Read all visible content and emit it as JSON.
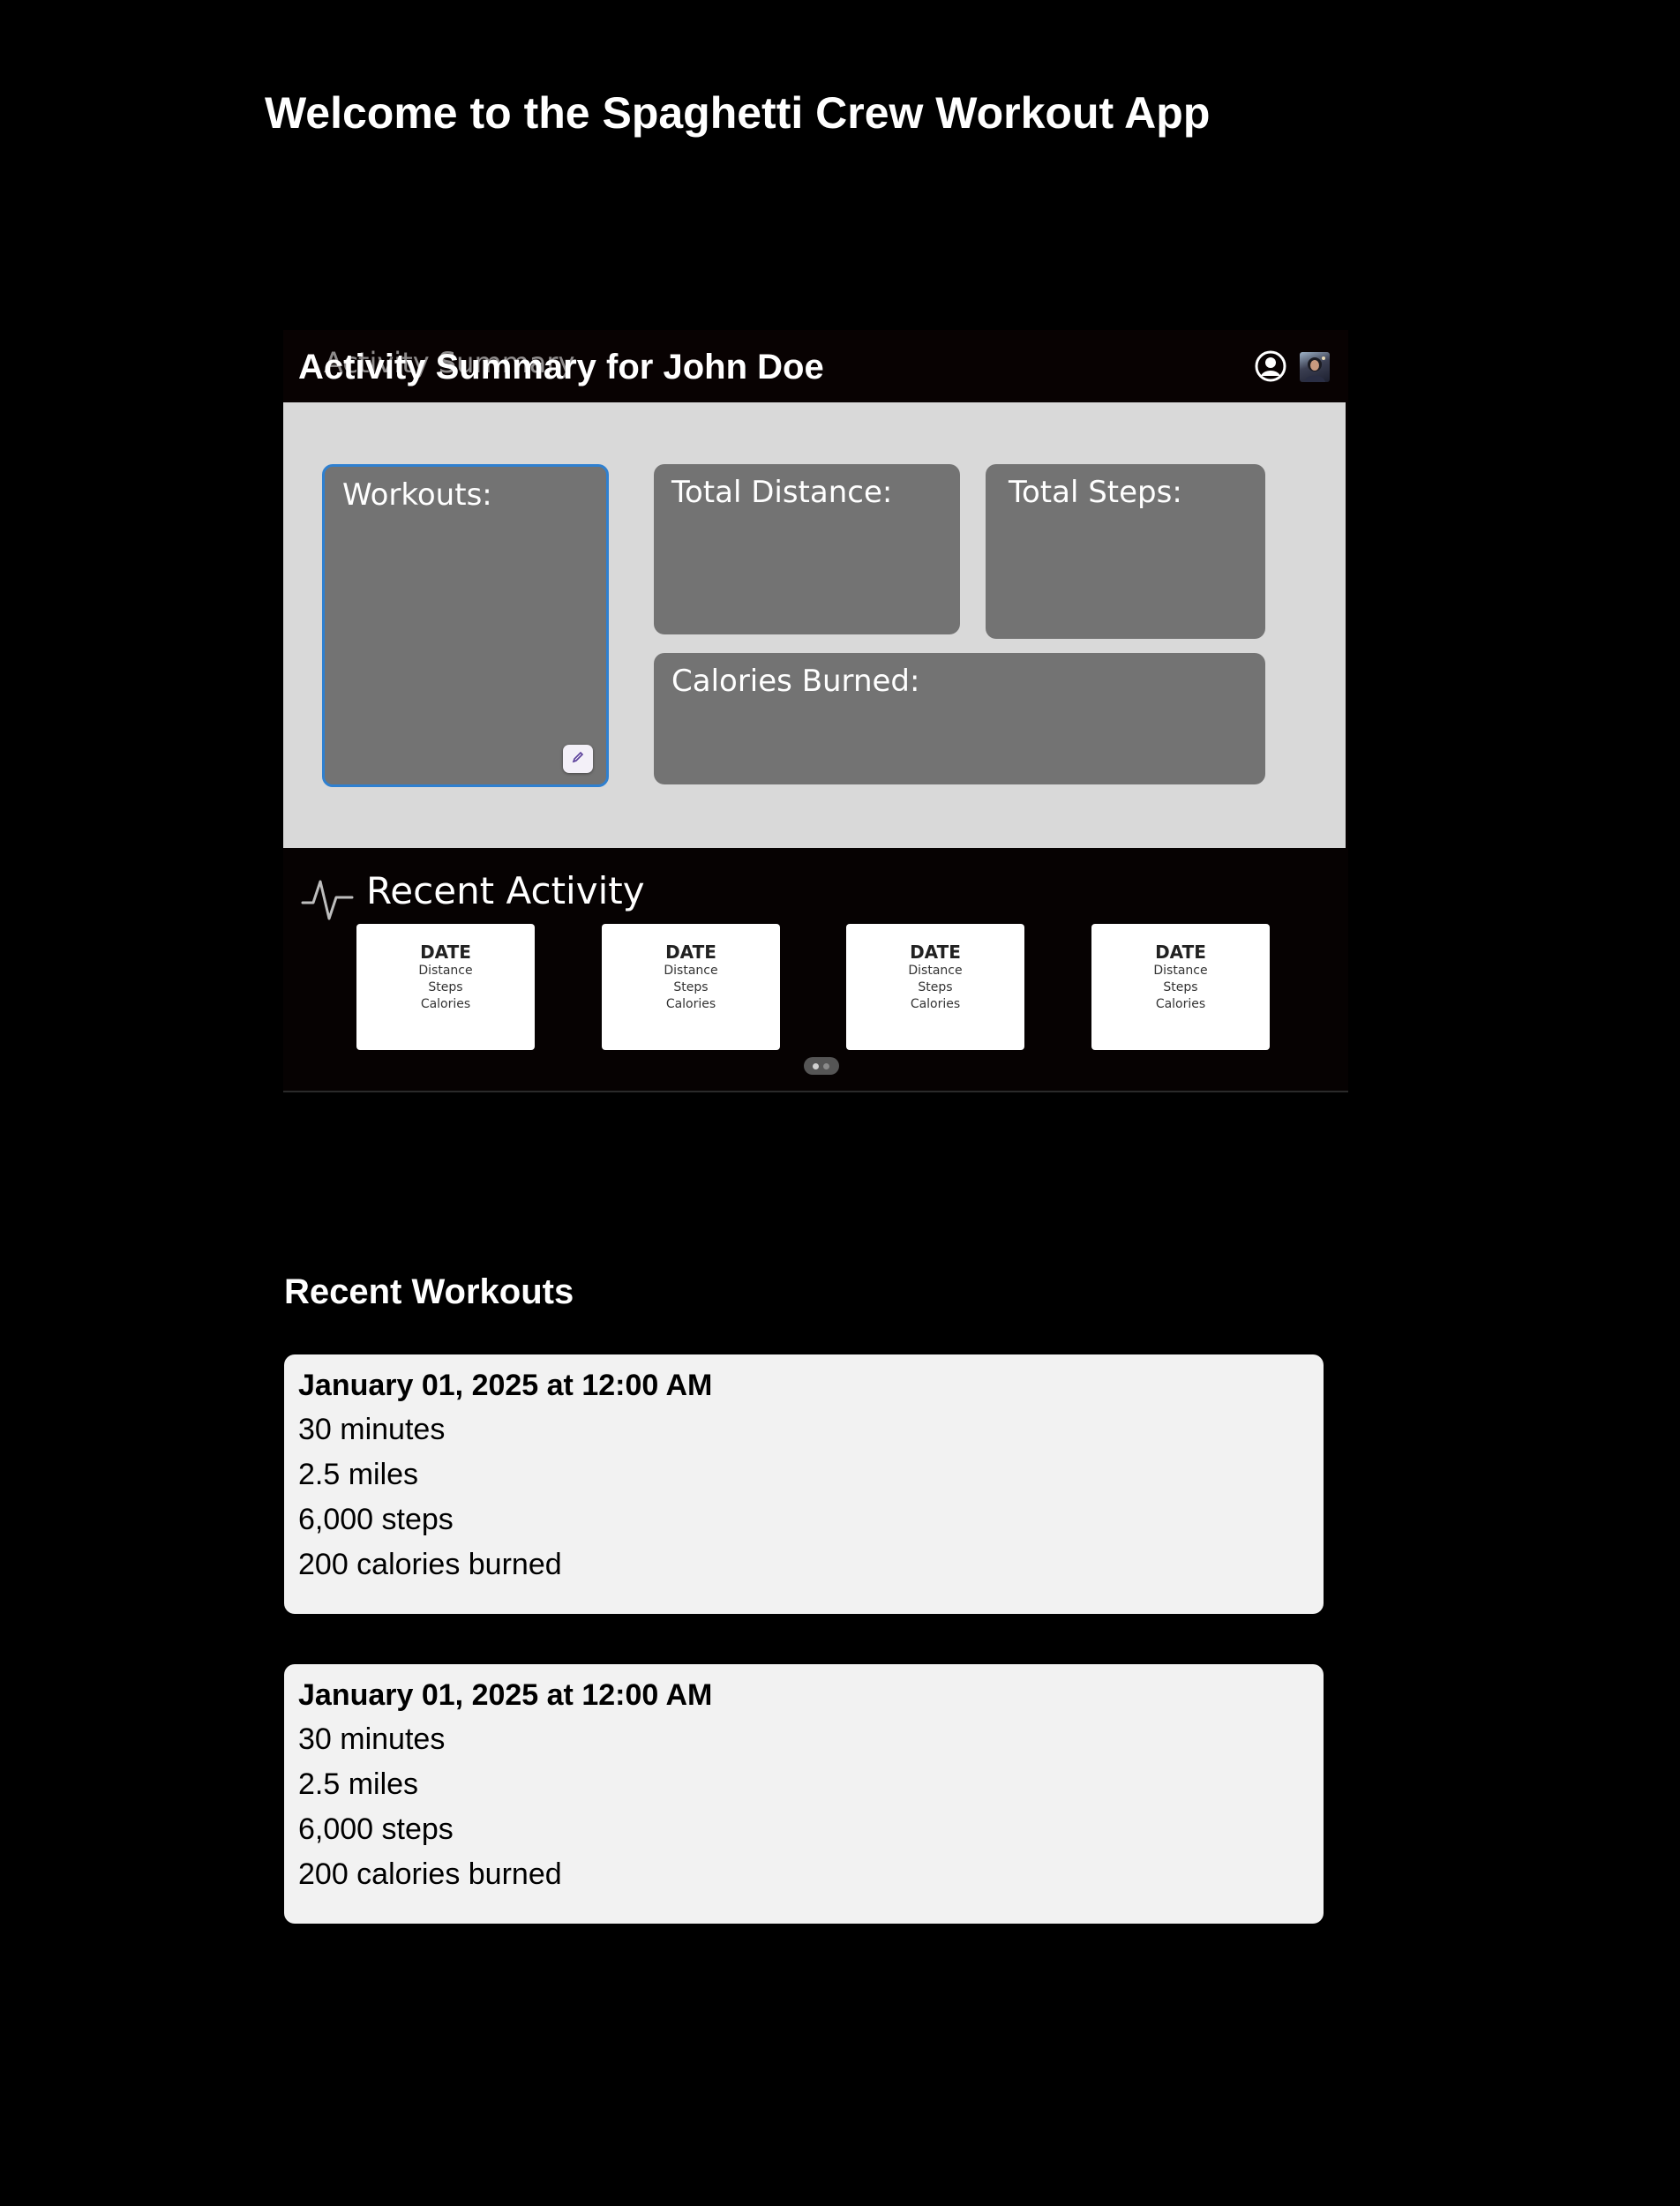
{
  "app": {
    "title": "Welcome to the Spaghetti Crew Workout App"
  },
  "dashboard": {
    "ghost_title": "Activity Summary",
    "title": "Activity Summary for John Doe",
    "profile_icon": "user-circle-icon",
    "avatar": "user-avatar",
    "cards": {
      "workouts": "Workouts:",
      "distance": "Total Distance:",
      "steps": "Total Steps:",
      "calories": "Calories Burned:"
    },
    "edit_icon": "pencil-icon",
    "accent_color": "#2f80d0"
  },
  "recent_activity": {
    "heading": "Recent Activity",
    "icon": "pulse-icon",
    "cards": [
      {
        "date": "DATE",
        "distance": "Distance",
        "steps": "Steps",
        "calories": "Calories"
      },
      {
        "date": "DATE",
        "distance": "Distance",
        "steps": "Steps",
        "calories": "Calories"
      },
      {
        "date": "DATE",
        "distance": "Distance",
        "steps": "Steps",
        "calories": "Calories"
      },
      {
        "date": "DATE",
        "distance": "Distance",
        "steps": "Steps",
        "calories": "Calories"
      }
    ],
    "pager": {
      "pages": 2,
      "current": 1
    }
  },
  "recent_workouts": {
    "heading": "Recent Workouts",
    "items": [
      {
        "date": "January 01, 2025 at 12:00 AM",
        "duration": "30 minutes",
        "distance": "2.5 miles",
        "steps": "6,000 steps",
        "calories": "200 calories burned"
      },
      {
        "date": "January 01, 2025 at 12:00 AM",
        "duration": "30 minutes",
        "distance": "2.5 miles",
        "steps": "6,000 steps",
        "calories": "200 calories burned"
      }
    ]
  }
}
